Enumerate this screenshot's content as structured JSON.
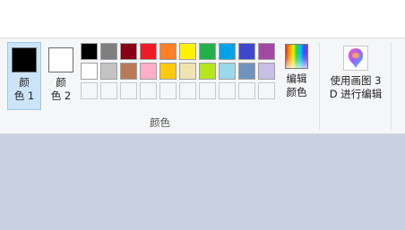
{
  "ribbon": {
    "color1_label": "颜\n色 1",
    "color2_label": "颜\n色 2",
    "edit_colors_label": "编辑\n颜色",
    "paint3d_label": "使用画图 3\nD 进行编辑",
    "group_label": "颜色"
  },
  "palette": {
    "row1": [
      "#000000",
      "#7f7f7f",
      "#880015",
      "#ed1c24",
      "#ff7f27",
      "#fff200",
      "#22b14c",
      "#00a2e8",
      "#3f48cc",
      "#a349a4"
    ],
    "row2": [
      "#ffffff",
      "#c3c3c3",
      "#b97a57",
      "#ffaec9",
      "#ffc90e",
      "#efe4b0",
      "#b5e61d",
      "#99d9ea",
      "#7092be",
      "#c8bfe7"
    ],
    "custom_slots": 10
  },
  "icons": {
    "edit_colors": "rainbow-gradient-icon",
    "paint3d": "paint-3d-icon"
  }
}
